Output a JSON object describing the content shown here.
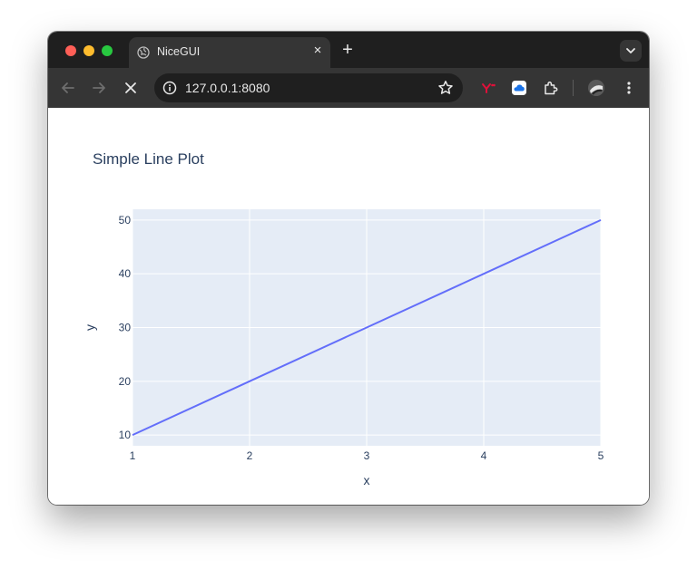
{
  "browser": {
    "tab": {
      "title": "NiceGUI",
      "close_label": "×"
    },
    "new_tab_label": "+",
    "address": {
      "url": "127.0.0.1:8080"
    }
  },
  "colors": {
    "line": "#636efa",
    "plot_bg": "#e5ecf6",
    "grid": "#ffffff",
    "text": "#2a3f5f"
  },
  "chart_data": {
    "type": "line",
    "title": "Simple Line Plot",
    "xlabel": "x",
    "ylabel": "y",
    "x": [
      1,
      2,
      3,
      4,
      5
    ],
    "series": [
      {
        "values": [
          10,
          20,
          30,
          40,
          50
        ]
      }
    ],
    "xlim": [
      1,
      5
    ],
    "ylim": [
      8,
      52
    ],
    "xticks": [
      1,
      2,
      3,
      4,
      5
    ],
    "yticks": [
      10,
      20,
      30,
      40,
      50
    ],
    "grid": true
  }
}
